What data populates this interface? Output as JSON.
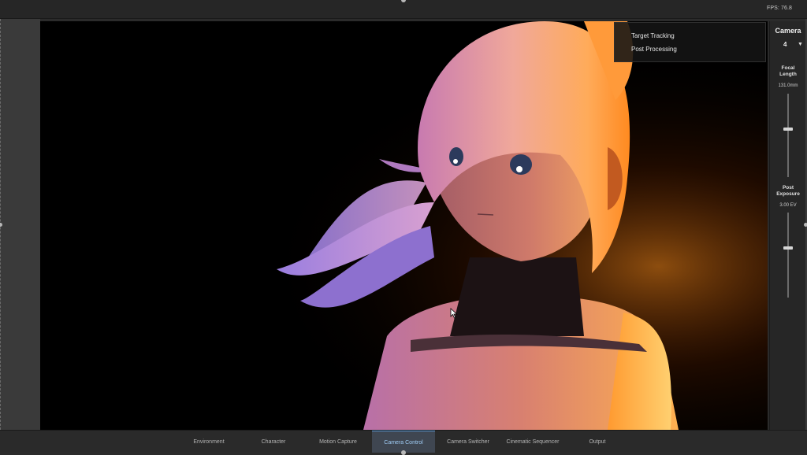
{
  "status": {
    "fps": "FPS: 76.8"
  },
  "dropdown": {
    "items": [
      "Target Tracking",
      "Post Processing"
    ]
  },
  "camera_panel": {
    "title": "Camera",
    "camera_number": "4",
    "focal_length": {
      "label_line1": "Focal",
      "label_line2": "Length",
      "value": "131.0mm",
      "slider_fraction": 0.58
    },
    "post_exposure": {
      "label_line1": "Post",
      "label_line2": "Exposure",
      "value": "3.00 EV",
      "slider_fraction": 0.58
    }
  },
  "tabs": [
    {
      "label": "Environment",
      "active": false
    },
    {
      "label": "Character",
      "active": false
    },
    {
      "label": "Motion Capture",
      "active": false
    },
    {
      "label": "Camera Control",
      "active": true
    },
    {
      "label": "Camera Switcher",
      "active": false
    },
    {
      "label": "Cinematic Sequencer",
      "active": false
    },
    {
      "label": "Output",
      "active": false
    }
  ],
  "colors": {
    "accent": "#5a9bd8",
    "active_tab_text": "#9ecbf4",
    "rim_light": "#ff9a2e",
    "hair_purple": "#8f6ad8"
  },
  "icons": [
    "chevron-down-icon",
    "mouse-cursor-icon"
  ]
}
